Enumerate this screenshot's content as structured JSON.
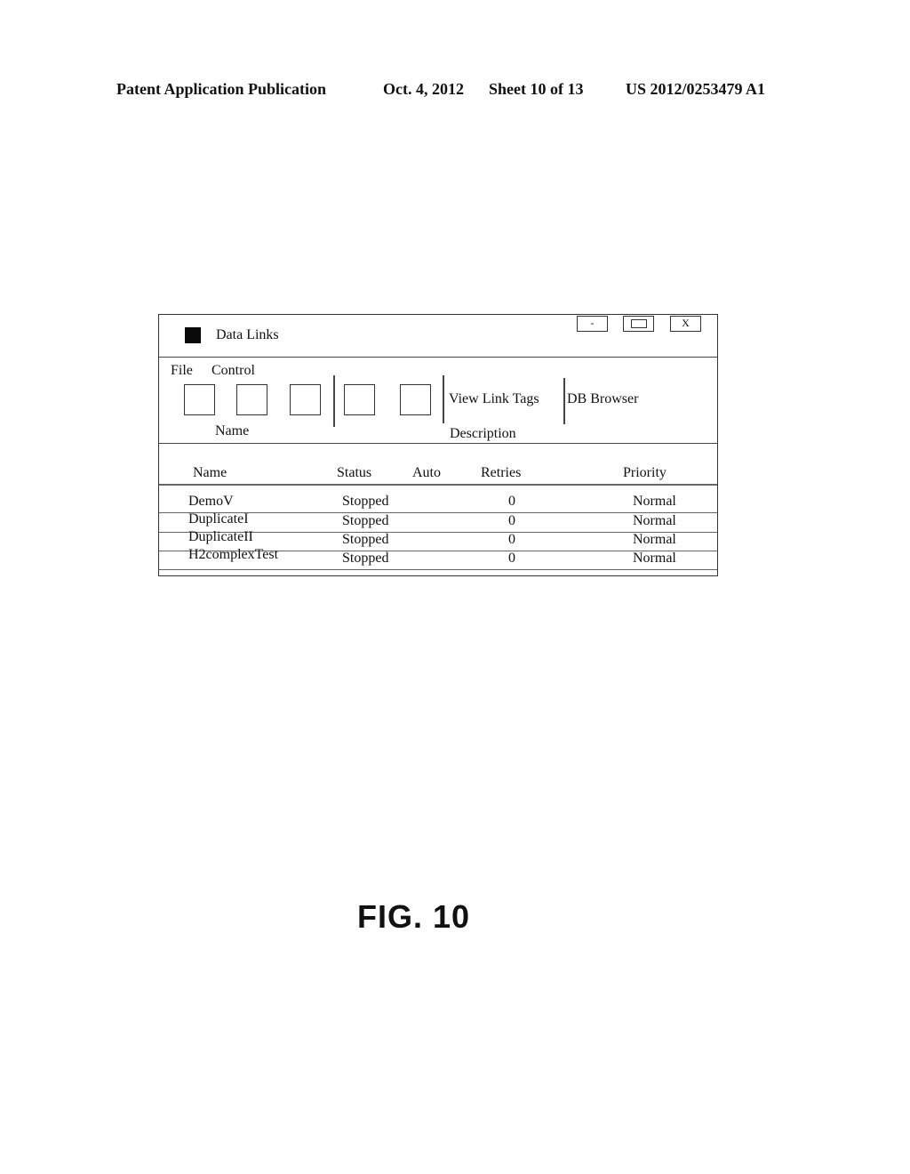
{
  "header": {
    "publication": "Patent Application Publication",
    "date": "Oct. 4, 2012",
    "sheet": "Sheet 10 of 13",
    "number": "US 2012/0253479 A1"
  },
  "window": {
    "title": "Data Links",
    "icon": "app-icon",
    "controls": {
      "minimize": "-",
      "maximize": "maximize-icon",
      "close": "X"
    }
  },
  "toolbar": {
    "menus": [
      "File",
      "Control"
    ],
    "buttons": 5,
    "links": [
      "View Link Tags",
      "DB Browser"
    ],
    "labels": {
      "name": "Name",
      "description": "Description"
    }
  },
  "table": {
    "columns": [
      "Name",
      "Status",
      "Auto",
      "Retries",
      "Priority"
    ],
    "rows": [
      {
        "name": "DemoV",
        "status": "Stopped",
        "auto": "",
        "retries": "0",
        "priority": "Normal"
      },
      {
        "name": "DuplicateI",
        "status": "Stopped",
        "auto": "",
        "retries": "0",
        "priority": "Normal"
      },
      {
        "name": "DuplicateII",
        "status": "Stopped",
        "auto": "",
        "retries": "0",
        "priority": "Normal"
      },
      {
        "name": "H2complexTest",
        "status": "Stopped",
        "auto": "",
        "retries": "0",
        "priority": "Normal"
      }
    ]
  },
  "figure_label": "FIG. 10"
}
